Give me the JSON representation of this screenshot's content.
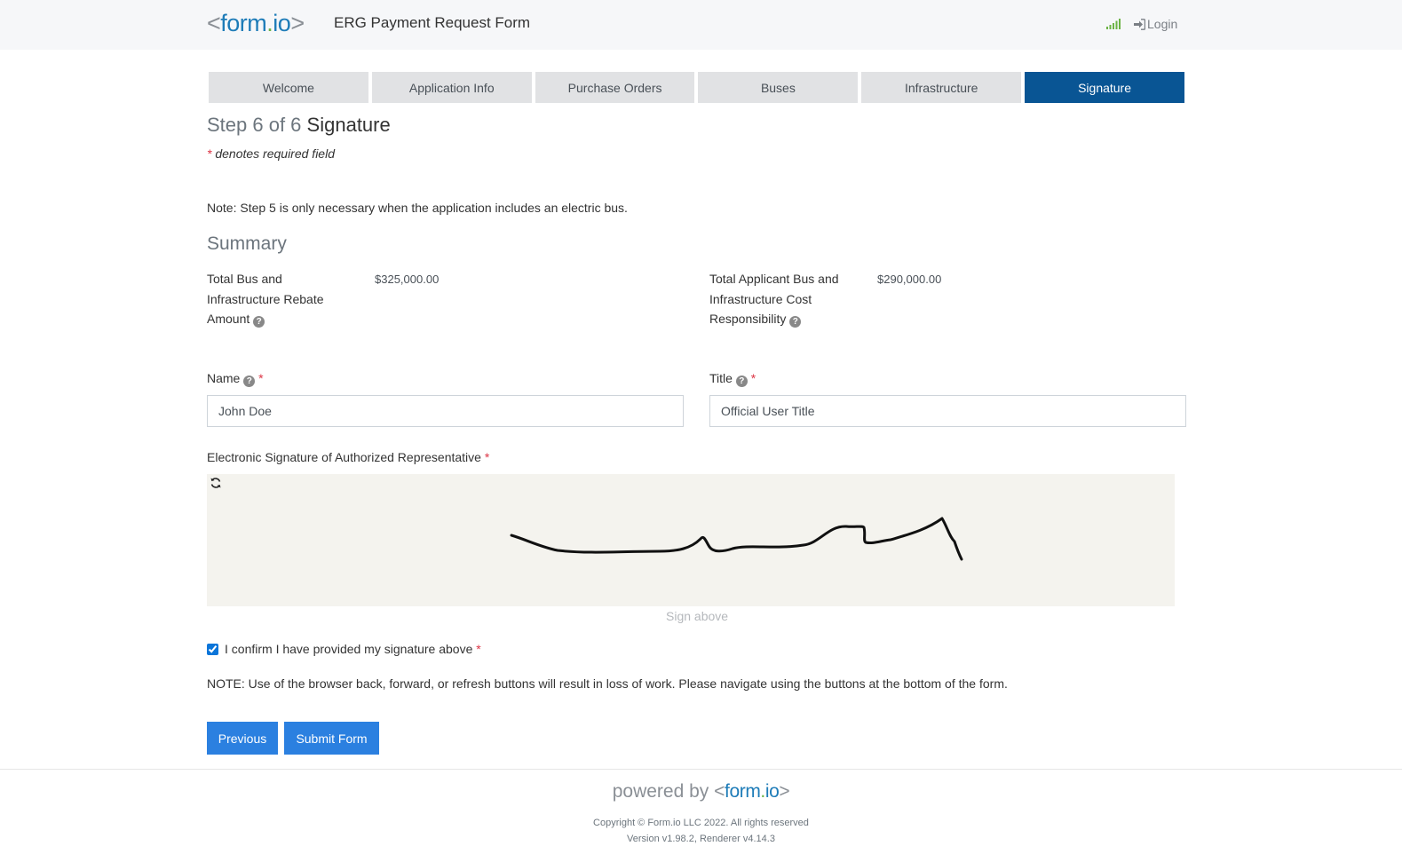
{
  "header": {
    "logo": {
      "open": "<",
      "form": "form",
      "dot": ".",
      "io": "io",
      "close": ">"
    },
    "app_title": "ERG Payment Request Form",
    "login_label": "Login",
    "colors": {
      "brand_blue": "#1e7cb8",
      "brand_green": "#6bb344"
    }
  },
  "wizard": {
    "tabs": [
      {
        "label": "Welcome",
        "active": false
      },
      {
        "label": "Application Info",
        "active": false
      },
      {
        "label": "Purchase Orders",
        "active": false
      },
      {
        "label": "Buses",
        "active": false
      },
      {
        "label": "Infrastructure",
        "active": false
      },
      {
        "label": "Signature",
        "active": true
      }
    ],
    "step_prefix": "Step 6 of 6",
    "step_name": "Signature",
    "required_note_star": "*",
    "required_note": "denotes required field",
    "active_color": "#095594"
  },
  "form": {
    "note_step5": "Note: Step 5 is only necessary when the application includes an electric bus.",
    "summary_heading": "Summary",
    "summary": {
      "rebate_label": "Total Bus and Infrastructure Rebate Amount",
      "rebate_value": "$325,000.00",
      "responsibility_label": "Total Applicant Bus and Infrastructure Cost Responsibility",
      "responsibility_value": "$290,000.00"
    },
    "name_label": "Name",
    "name_value": "John Doe",
    "title_label": "Title",
    "title_value": "Official User Title",
    "signature_label": "Electronic Signature of Authorized Representative",
    "sign_above": "Sign above",
    "confirm_label": "I confirm I have provided my signature above",
    "confirm_checked": true,
    "nav_note": "NOTE: Use of the browser back, forward, or refresh buttons will result in loss of work. Please navigate using the buttons at the bottom of the form.",
    "required_star": "*",
    "help_icon": "question-circle-icon"
  },
  "buttons": {
    "previous": "Previous",
    "submit": "Submit Form",
    "color": "#2b80e0"
  },
  "footer": {
    "powered_by": "powered by",
    "copyright": "Copyright © Form.io LLC 2022. All rights reserved",
    "version": "Version v1.98.2, Renderer v4.14.3"
  }
}
